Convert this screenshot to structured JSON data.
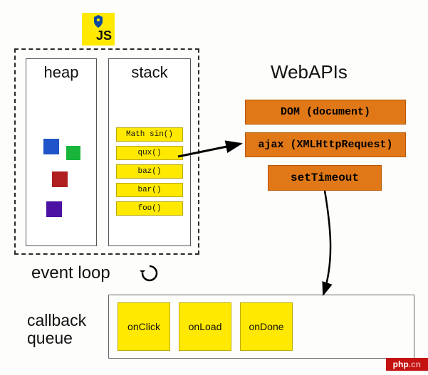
{
  "badge": {
    "label": "JS"
  },
  "runtime": {
    "heap_title": "heap",
    "stack_title": "stack",
    "stack_frames": [
      "Math sin()",
      "qux()",
      "baz()",
      "bar()",
      "foo()"
    ]
  },
  "webapis": {
    "title": "WebAPIs",
    "dom": "DOM (document)",
    "ajax": "ajax (XMLHttpRequest)",
    "settimeout": "setTimeout"
  },
  "event_loop_label": "event loop",
  "callback_queue": {
    "label": "callback\nqueue",
    "items": [
      "onClick",
      "onLoad",
      "onDone"
    ]
  },
  "watermark": {
    "left": "php",
    "right": ".cn"
  },
  "chart_data": {
    "type": "diagram",
    "title": "JavaScript runtime / event loop model",
    "nodes": [
      {
        "id": "heap",
        "label": "heap",
        "group": "runtime"
      },
      {
        "id": "stack",
        "label": "stack",
        "group": "runtime",
        "contents": [
          "Math sin()",
          "qux()",
          "baz()",
          "bar()",
          "foo()"
        ]
      },
      {
        "id": "webapis",
        "label": "WebAPIs",
        "contents": [
          "DOM (document)",
          "ajax (XMLHttpRequest)",
          "setTimeout"
        ]
      },
      {
        "id": "callback_queue",
        "label": "callback queue",
        "contents": [
          "onClick",
          "onLoad",
          "onDone"
        ]
      },
      {
        "id": "event_loop",
        "label": "event loop"
      }
    ],
    "edges": [
      {
        "from": "stack",
        "to": "webapis"
      },
      {
        "from": "webapis",
        "to": "callback_queue"
      },
      {
        "from": "callback_queue",
        "to": "stack",
        "via": "event_loop"
      }
    ]
  }
}
